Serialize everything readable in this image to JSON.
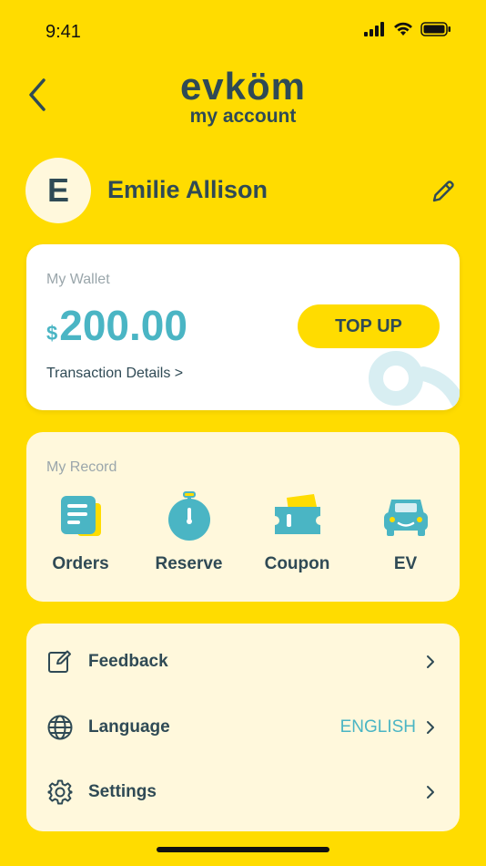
{
  "status": {
    "time": "9:41"
  },
  "header": {
    "logo": "evköm",
    "subtitle": "my account"
  },
  "profile": {
    "initial": "E",
    "name": "Emilie Allison"
  },
  "wallet": {
    "label": "My Wallet",
    "currency": "$",
    "amount": "200.00",
    "transaction_link": "Transaction Details >",
    "topup_label": "TOP UP"
  },
  "record": {
    "label": "My Record",
    "items": [
      {
        "label": "Orders",
        "icon": "orders-icon"
      },
      {
        "label": "Reserve",
        "icon": "stopwatch-icon"
      },
      {
        "label": "Coupon",
        "icon": "coupon-icon"
      },
      {
        "label": "EV",
        "icon": "car-icon"
      }
    ]
  },
  "menu": {
    "items": [
      {
        "label": "Feedback",
        "icon": "feedback-icon",
        "value": ""
      },
      {
        "label": "Language",
        "icon": "globe-icon",
        "value": "ENGLISH"
      },
      {
        "label": "Settings",
        "icon": "gear-icon",
        "value": ""
      }
    ]
  },
  "colors": {
    "background": "#FFDC00",
    "accent": "#4AB5C4",
    "text": "#2F4A55",
    "card_light": "#FFF8DC"
  }
}
